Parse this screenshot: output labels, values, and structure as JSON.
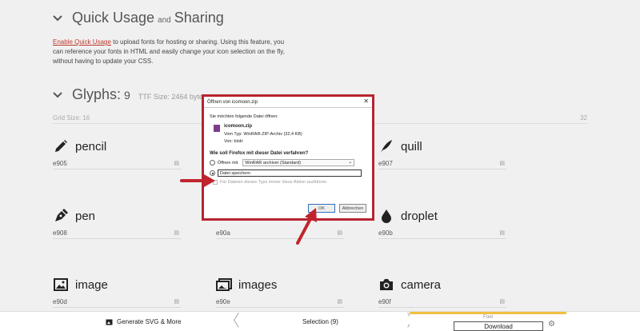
{
  "quick_usage": {
    "title_part1": "Quick Usage",
    "title_and": "and",
    "title_part2": "Sharing",
    "link_text": "Enable Quick Usage",
    "desc_text": " to upload fonts for hosting or sharing. Using this feature, you can reference your fonts in HTML and easily change your icon selection on the fly, without having to update your CSS."
  },
  "glyphs_section": {
    "title": "Glyphs:",
    "count": "9",
    "ttf_size": "TTF Size: 2464 bytes",
    "grid_label": "Grid Size: 16",
    "grid_max": "32"
  },
  "glyphs": [
    {
      "name": "pencil",
      "code": "e905",
      "icon": "pencil-icon"
    },
    {
      "name": "quill",
      "code": "e907",
      "icon": "quill-icon"
    },
    {
      "name": "pen",
      "code": "e908",
      "icon": "pen-icon"
    },
    {
      "name": "",
      "code": "e90a",
      "icon": "blank"
    },
    {
      "name": "droplet",
      "code": "e90b",
      "icon": "droplet-icon"
    },
    {
      "name": "image",
      "code": "e90d",
      "icon": "image-icon"
    },
    {
      "name": "images",
      "code": "e90e",
      "icon": "images-icon"
    },
    {
      "name": "camera",
      "code": "e90f",
      "icon": "camera-icon"
    }
  ],
  "bottombar": {
    "generate": "Generate SVG & More",
    "selection": "Selection (9)",
    "font_label": "Font",
    "download": "Download"
  },
  "dialog": {
    "title": "Öffnen von icomoon.zip",
    "close": "✕",
    "question": "Sie möchten folgende Datei öffnen:",
    "file_name": "icomoon.zip",
    "type_line": "Vom Typ:  WinRAR-ZIP-Archiv (32,4 KB)",
    "from_line": "Von:  blob:",
    "what_label": "Wie soll Firefox mit dieser Datei verfahren?",
    "open_with": "Öffnen mit",
    "open_with_app": "WinRAR archiver (Standard)",
    "save_file": "Datei speichern",
    "always_check": "Für Dateien dieses Typs immer diese Aktion ausführen",
    "ok": "OK",
    "cancel": "Abbrechen"
  },
  "colors": {
    "accent_red": "#b8232f",
    "link_red": "#c0392b",
    "font_tab_yellow": "#f0c040"
  }
}
